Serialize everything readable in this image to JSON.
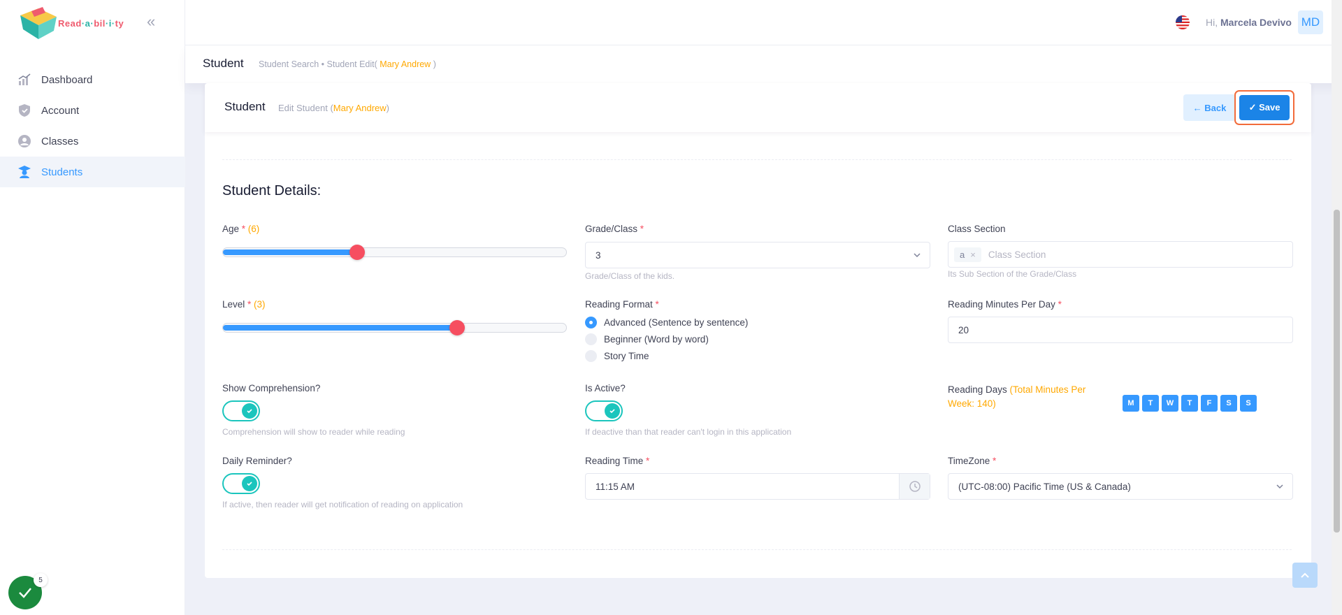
{
  "brand": {
    "logo_text_parts": [
      "Read",
      "·a·",
      "bil",
      "·i·",
      "ty"
    ]
  },
  "nav": {
    "items": [
      {
        "label": "Dashboard",
        "icon": "chart-icon"
      },
      {
        "label": "Account",
        "icon": "shield-icon"
      },
      {
        "label": "Classes",
        "icon": "users-circle-icon"
      },
      {
        "label": "Students",
        "icon": "student-icon",
        "active": true
      }
    ]
  },
  "header": {
    "greeting": "Hi,",
    "user_name": "Marcela Devivo",
    "avatar_initials": "MD"
  },
  "subheader": {
    "title": "Student",
    "crumb_1": "Student Search",
    "crumb_sep": "•",
    "crumb_2": "Student Edit(",
    "crumb_2_name": " Mary Andrew ",
    "crumb_2_end": ")"
  },
  "card": {
    "title": "Student",
    "subtitle": "Edit Student (",
    "subtitle_name": "Mary Andrew",
    "subtitle_end": ")",
    "back_label": "← Back",
    "save_label": "✓ Save"
  },
  "form": {
    "section_title": "Student Details:",
    "age": {
      "label": "Age",
      "req": " *",
      "value_text": " (6)",
      "fraction": 0.39
    },
    "level": {
      "label": "Level",
      "req": " *",
      "value_text": " (3)",
      "fraction": 0.68
    },
    "grade": {
      "label": "Grade/Class",
      "req": " *",
      "value": "3",
      "hint": "Grade/Class of the kids."
    },
    "class_section": {
      "label": "Class Section",
      "tag": "a",
      "placeholder": "Class Section",
      "hint": "Its Sub Section of the Grade/Class"
    },
    "reading_format": {
      "label": "Reading Format",
      "req": " *",
      "options": [
        "Advanced (Sentence by sentence)",
        "Beginner (Word by word)",
        "Story Time"
      ],
      "selected": 0
    },
    "minutes": {
      "label": "Reading Minutes Per Day",
      "req": " *",
      "value": "20"
    },
    "show_comprehension": {
      "label": "Show Comprehension?",
      "hint": "Comprehension will show to reader while reading",
      "on": true
    },
    "is_active": {
      "label": "Is Active?",
      "hint": "If deactive than that reader can't login in this application",
      "on": true
    },
    "reading_days": {
      "label": "Reading Days",
      "total_line_1": " (Total Minutes Per",
      "total_line_2": "Week: 140)",
      "days": [
        "M",
        "T",
        "W",
        "T",
        "F",
        "S",
        "S"
      ]
    },
    "daily_reminder": {
      "label": "Daily Reminder?",
      "hint": "If active, then reader will get notification of reading on application",
      "on": true
    },
    "reading_time": {
      "label": "Reading Time",
      "req": " *",
      "value": "11:15 AM"
    },
    "timezone": {
      "label": "TimeZone",
      "req": " *",
      "value": "(UTC-08:00) Pacific Time (US & Canada)"
    }
  },
  "fab": {
    "badge": "5"
  },
  "colors": {
    "primary": "#3699ff",
    "accent": "#ffa800",
    "danger": "#f64e60",
    "success": "#1bc5bd"
  }
}
